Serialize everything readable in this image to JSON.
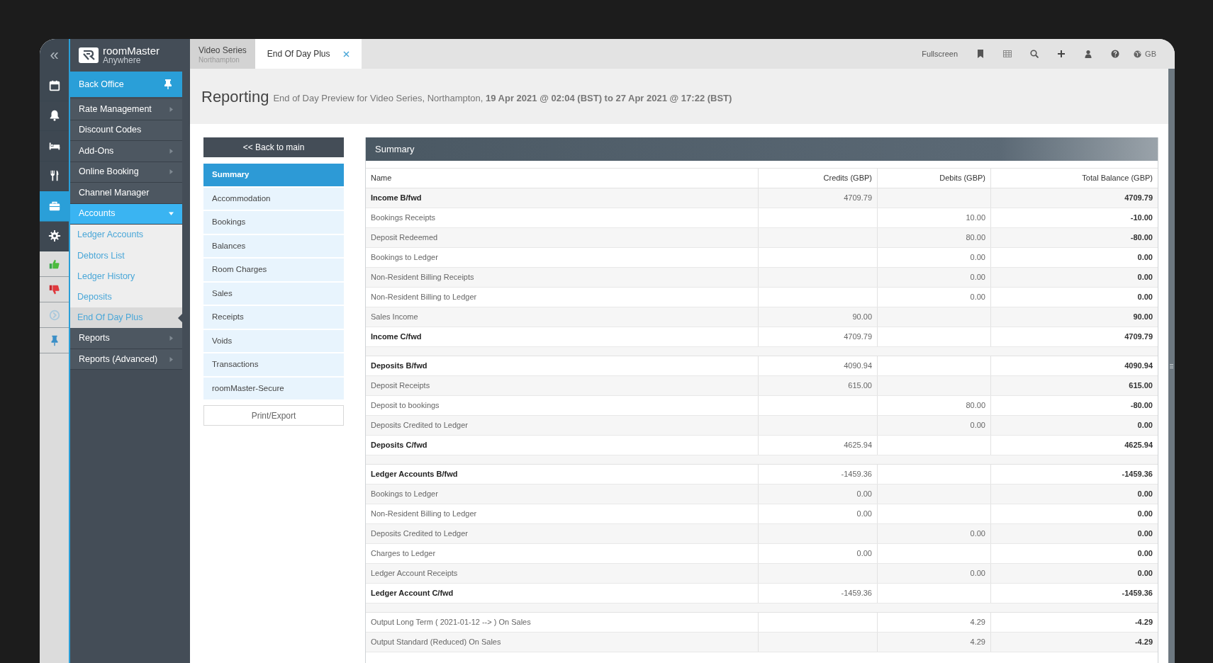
{
  "rail": {
    "collapse": "«",
    "icons": [
      {
        "kind": "calendar",
        "selected": false
      },
      {
        "kind": "bell",
        "selected": false
      },
      {
        "kind": "bed",
        "selected": false
      },
      {
        "kind": "cutlery",
        "selected": false
      },
      {
        "kind": "briefcase",
        "selected": true
      },
      {
        "kind": "gear",
        "selected": false
      },
      {
        "kind": "thumbs-up",
        "selected": false
      },
      {
        "kind": "thumbs-down",
        "selected": false
      },
      {
        "kind": "circle-arrow",
        "selected": false
      },
      {
        "kind": "pin",
        "selected": false
      }
    ]
  },
  "logo": {
    "name": "roomMaster",
    "tagline": "Anywhere"
  },
  "menu": [
    {
      "label": "Back Office",
      "kind": "header",
      "pinned": true
    },
    {
      "label": "Rate Management",
      "kind": "item",
      "has_submenu": true,
      "selected": false
    },
    {
      "label": "Discount Codes",
      "kind": "item",
      "has_submenu": false,
      "selected": false
    },
    {
      "label": "Add-Ons",
      "kind": "item",
      "has_submenu": true,
      "selected": false
    },
    {
      "label": "Online Booking",
      "kind": "item",
      "has_submenu": true,
      "selected": false
    },
    {
      "label": "Channel Manager",
      "kind": "item",
      "has_submenu": false,
      "selected": false
    },
    {
      "label": "Accounts",
      "kind": "item",
      "has_submenu": true,
      "selected": true,
      "expanded": true,
      "children": [
        {
          "label": "Ledger Accounts",
          "selected": false
        },
        {
          "label": "Debtors List",
          "selected": false
        },
        {
          "label": "Ledger History",
          "selected": false
        },
        {
          "label": "Deposits",
          "selected": false
        },
        {
          "label": "End Of Day Plus",
          "selected": true
        }
      ]
    },
    {
      "label": "Reports",
      "kind": "item",
      "has_submenu": true,
      "selected": false
    },
    {
      "label": "Reports (Advanced)",
      "kind": "item",
      "has_submenu": true,
      "selected": false
    }
  ],
  "tabs": [
    {
      "title": "Video Series",
      "subtitle": "Northampton",
      "selected": false,
      "closable": false
    },
    {
      "title": "End Of Day Plus",
      "selected": true,
      "closable": true
    }
  ],
  "toolbar": {
    "fullscreen": "Fullscreen",
    "icons": [
      {
        "kind": "bookmark"
      },
      {
        "kind": "grid"
      },
      {
        "kind": "search"
      },
      {
        "kind": "plus"
      },
      {
        "kind": "user"
      },
      {
        "kind": "help"
      }
    ],
    "locale": "GB"
  },
  "header": {
    "title": "Reporting",
    "subtitle": "End of Day Preview for Video Series, Northampton, **19 Apr 2021 @ 02:04 (BST) to 27 Apr 2021 @ 17:22 (BST)**"
  },
  "report_nav": {
    "back": "<< Back to main",
    "items": [
      {
        "label": "Summary",
        "selected": true
      },
      {
        "label": "Accommodation",
        "selected": false
      },
      {
        "label": "Bookings",
        "selected": false
      },
      {
        "label": "Balances",
        "selected": false
      },
      {
        "label": "Room Charges",
        "selected": false
      },
      {
        "label": "Sales",
        "selected": false
      },
      {
        "label": "Receipts",
        "selected": false
      },
      {
        "label": "Voids",
        "selected": false
      },
      {
        "label": "Transactions",
        "selected": false
      },
      {
        "label": "roomMaster-Secure",
        "selected": false
      }
    ],
    "print": "Print/Export"
  },
  "summary": {
    "title": "Summary",
    "columns": [
      "Name",
      "Credits (GBP)",
      "Debits (GBP)",
      "Total Balance (GBP)"
    ],
    "sections": [
      {
        "rows": [
          {
            "name": "Income B/fwd",
            "credits": "4709.79",
            "total": "4709.79",
            "emphasis": true
          },
          {
            "name": "Bookings Receipts",
            "debits": "10.00",
            "total": "-10.00",
            "emphasis": false
          },
          {
            "name": "Deposit Redeemed",
            "debits": "80.00",
            "total": "-80.00",
            "emphasis": false
          },
          {
            "name": "Bookings to Ledger",
            "debits": "0.00",
            "total": "0.00",
            "emphasis": false
          },
          {
            "name": "Non-Resident Billing Receipts",
            "debits": "0.00",
            "total": "0.00",
            "emphasis": false
          },
          {
            "name": "Non-Resident Billing to Ledger",
            "debits": "0.00",
            "total": "0.00",
            "emphasis": false
          },
          {
            "name": "Sales Income",
            "credits": "90.00",
            "total": "90.00",
            "emphasis": false
          },
          {
            "name": "Income C/fwd",
            "credits": "4709.79",
            "total": "4709.79",
            "emphasis": true
          }
        ]
      },
      {
        "rows": [
          {
            "name": "Deposits B/fwd",
            "credits": "4090.94",
            "total": "4090.94",
            "emphasis": true
          },
          {
            "name": "Deposit Receipts",
            "credits": "615.00",
            "total": "615.00",
            "emphasis": false
          },
          {
            "name": "Deposit to bookings",
            "debits": "80.00",
            "total": "-80.00",
            "emphasis": false
          },
          {
            "name": "Deposits Credited to Ledger",
            "debits": "0.00",
            "total": "0.00",
            "emphasis": false
          },
          {
            "name": "Deposits C/fwd",
            "credits": "4625.94",
            "total": "4625.94",
            "emphasis": true
          }
        ]
      },
      {
        "rows": [
          {
            "name": "Ledger Accounts B/fwd",
            "credits": "-1459.36",
            "total": "-1459.36",
            "emphasis": true
          },
          {
            "name": "Bookings to Ledger",
            "credits": "0.00",
            "total": "0.00",
            "emphasis": false
          },
          {
            "name": "Non-Resident Billing to Ledger",
            "credits": "0.00",
            "total": "0.00",
            "emphasis": false
          },
          {
            "name": "Deposits Credited to Ledger",
            "debits": "0.00",
            "total": "0.00",
            "emphasis": false
          },
          {
            "name": "Charges to Ledger",
            "credits": "0.00",
            "total": "0.00",
            "emphasis": false
          },
          {
            "name": "Ledger Account Receipts",
            "debits": "0.00",
            "total": "0.00",
            "emphasis": false
          },
          {
            "name": "Ledger Account C/fwd",
            "credits": "-1459.36",
            "total": "-1459.36",
            "emphasis": true
          }
        ]
      },
      {
        "rows": [
          {
            "name": "Output Long Term ( 2021-01-12 --> ) On Sales",
            "debits": "4.29",
            "total": "-4.29",
            "emphasis": false
          },
          {
            "name": "Output Standard (Reduced) On Sales",
            "debits": "4.29",
            "total": "-4.29",
            "emphasis": false
          }
        ]
      }
    ]
  }
}
